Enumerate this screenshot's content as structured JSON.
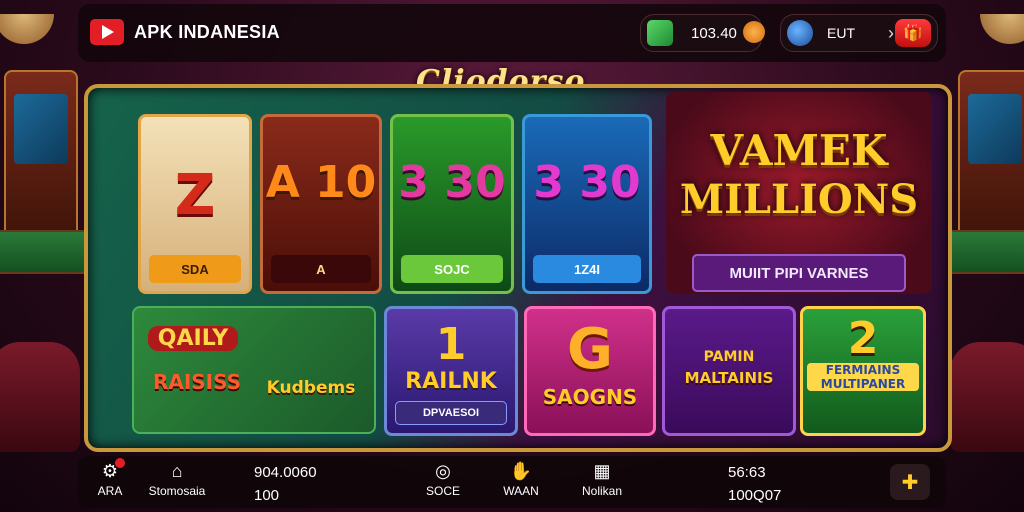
{
  "header": {
    "brand": "APK INDANESIA",
    "coins": "103.40",
    "region_code": "EUT"
  },
  "logo": "Cliodorso",
  "reels": [
    {
      "symbol": "Z",
      "label": "SDA"
    },
    {
      "symbol": "A 10",
      "label": "A"
    },
    {
      "symbol": "3 30",
      "label": "SOJC"
    },
    {
      "symbol": "3 30",
      "label": "1Z4I"
    }
  ],
  "featured": {
    "line1": "VAMEK",
    "line2": "MILLIONS",
    "button": "MUIIT PIPI VARNES"
  },
  "games": [
    {
      "title": "QAILY",
      "subtitle": "RAISISS",
      "extra": "Kudbems"
    },
    {
      "title": "1",
      "subtitle": "RAILNK",
      "badge": "DPVAESOI"
    },
    {
      "title": "G",
      "subtitle": "SAOGNS"
    },
    {
      "title": "PAMIN",
      "subtitle": "MALTAINIS"
    },
    {
      "title": "2",
      "subtitle": "FERMIAINS MULTIPANER"
    }
  ],
  "bottom_nav": {
    "home_label": "ARA",
    "shop_label": "Stomosaia",
    "balance_top": "904.0060",
    "balance_bottom": "100",
    "btn1_label": "SOCE",
    "btn2_label": "WAAN",
    "btn3_label": "Nolikan",
    "stat_top": "56:63",
    "stat_bottom": "100Q07"
  },
  "colors": {
    "accent": "#c9973c",
    "brand_red": "#e41e26",
    "gold_text": "#ffcc2a"
  }
}
